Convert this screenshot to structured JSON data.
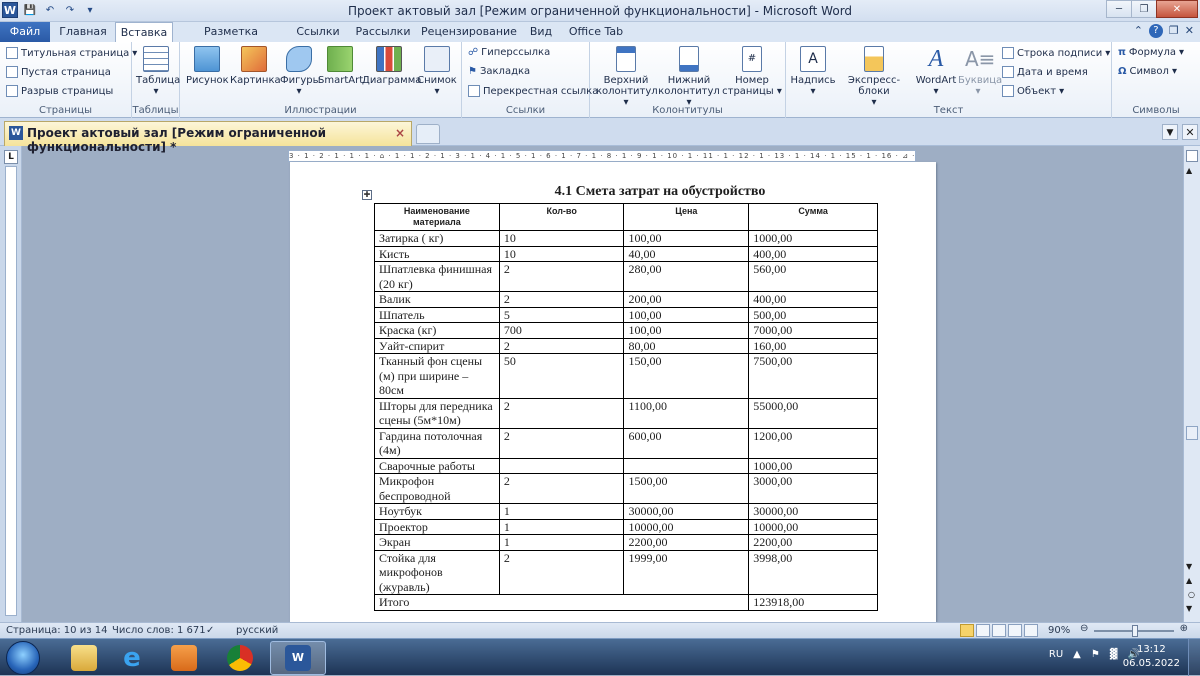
{
  "window": {
    "title": "Проект актовый зал [Режим ограниченной функциональности]  -  Microsoft Word",
    "app_letter": "W"
  },
  "tabs": [
    "Файл",
    "Главная",
    "Вставка",
    "Разметка страницы",
    "Ссылки",
    "Рассылки",
    "Рецензирование",
    "Вид",
    "Office Tab"
  ],
  "ribbon": {
    "pages": {
      "title_page": "Титульная страница",
      "blank_page": "Пустая страница",
      "page_break": "Разрыв страницы",
      "label": "Страницы"
    },
    "tables": {
      "table": "Таблица",
      "label": "Таблицы"
    },
    "illustrations": {
      "picture": "Рисунок",
      "clipart": "Картинка",
      "shapes": "Фигуры",
      "smartart": "SmartArt",
      "chart": "Диаграмма",
      "screenshot": "Снимок",
      "label": "Иллюстрации"
    },
    "links": {
      "hyperlink": "Гиперссылка",
      "bookmark": "Закладка",
      "crossref": "Перекрестная ссылка",
      "label": "Ссылки"
    },
    "header_footer": {
      "header": "Верхний",
      "header2": "колонтитул",
      "footer": "Нижний",
      "footer2": "колонтитул",
      "pagenum": "Номер",
      "pagenum2": "страницы",
      "label": "Колонтитулы"
    },
    "text": {
      "textbox": "Надпись",
      "quickparts": "Экспресс-блоки",
      "wordart": "WordArt",
      "dropcap": "Буквица",
      "sigline": "Строка подписи",
      "datetime": "Дата и время",
      "object": "Объект",
      "label": "Текст"
    },
    "symbols": {
      "equation": "Формула",
      "symbol": "Символ",
      "label": "Символы"
    }
  },
  "doc_tab": {
    "title": "Проект актовый зал [Режим ограниченной функциональности] *",
    "close": "×"
  },
  "ruler": {
    "h": "3 · 1 · 2 · 1 · 1 · 1 · ⌂ · 1 · 1 · 2 · 1 · 3 · 1 · 4 · 1 · 5 · 1 · 6 · 1 · 7 · 1 · 8 · 1 · 9 · 1 · 10 · 1 · 11 · 1 · 12 · 1 · 13 · 1 · 14 · 1 · 15 · 1 · 16 · ⊿ · 17 · 1 ·",
    "corner": "L"
  },
  "document": {
    "heading": "4.1 Смета затрат на обустройство",
    "columns": [
      "Наименование материала",
      "Кол-во",
      "Цена",
      "Сумма"
    ],
    "rows": [
      [
        "Затирка ( кг)",
        "10",
        "100,00",
        "1000,00"
      ],
      [
        "Кисть",
        "10",
        "40,00",
        "400,00"
      ],
      [
        "Шпатлевка финишная (20 кг)",
        "2",
        "280,00",
        "560,00"
      ],
      [
        "Валик",
        "2",
        "200,00",
        "400,00"
      ],
      [
        "Шпатель",
        "5",
        "100,00",
        "500,00"
      ],
      [
        "Краска (кг)",
        "700",
        "100,00",
        "7000,00"
      ],
      [
        "Уайт-спирит",
        "2",
        "80,00",
        "160,00"
      ],
      [
        "Тканный фон сцены (м) при ширине – 80см",
        "50",
        "150,00",
        "7500,00"
      ],
      [
        "Шторы для передника сцены (5м*10м)",
        "2",
        "1100,00",
        "55000,00"
      ],
      [
        "Гардина потолочная (4м)",
        "2",
        "600,00",
        "1200,00"
      ],
      [
        "Сварочные  работы",
        "",
        "",
        "1000,00"
      ],
      [
        "Микрофон беспроводной",
        "2",
        "1500,00",
        "3000,00"
      ],
      [
        "Ноутбук",
        "1",
        "30000,00",
        "30000,00"
      ],
      [
        "Проектор",
        "1",
        "10000,00",
        "10000,00"
      ],
      [
        "Экран",
        "1",
        "2200,00",
        "2200,00"
      ],
      [
        "Стойка для микрофонов (журавль)",
        "2",
        "1999,00",
        "3998,00"
      ]
    ],
    "total_label": "Итого",
    "total_value": "123918,00"
  },
  "status": {
    "page": "Страница: 10 из 14",
    "words": "Число слов: 1 671",
    "lang": "русский",
    "zoom": "90%"
  },
  "taskbar": {
    "lang": "RU",
    "time": "13:12",
    "date": "06.05.2022"
  },
  "colors": {
    "accent": "#2b579a",
    "file_tab": "#2a5aa6",
    "doc_tab": "#f5e39a"
  }
}
